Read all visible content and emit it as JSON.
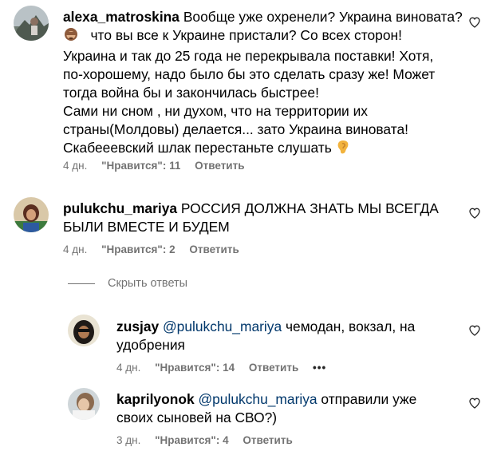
{
  "comments": [
    {
      "username": "alexa_matroskina",
      "lines": [
        " Вообще уже охренели? Украина виновата?",
        "   что вы все к Украине пристали? Со всех сторон!",
        "Украина и так до 25 года не перекрывала поставки! Хотя,",
        "по-хорошему, надо было бы это сделать сразу же! Может",
        "тогда война бы и закончилась быстрее!",
        "Сами ни сном , ни духом, что на территории их",
        "страны(Молдовы) делается... зато Украина виновата!",
        "Скабееевский шлак перестаньте слушать "
      ],
      "time": "4 дн.",
      "likes": "\"Нравится\": 11",
      "reply": "Ответить",
      "icons": {
        "emoji_1": "see-no-evil-monkey-emoji",
        "emoji_2": "ear-emoji",
        "like": "heart-outline-icon"
      }
    },
    {
      "username": "pulukchu_mariya",
      "lines": [
        " РОССИЯ ДОЛЖНА ЗНАТЬ МЫ ВСЕГДА",
        "БЫЛИ ВМЕСТЕ И БУДЕМ"
      ],
      "time": "4 дн.",
      "likes": "\"Нравится\": 2",
      "reply": "Ответить",
      "icons": {
        "like": "heart-outline-icon"
      }
    }
  ],
  "hide_replies": "Скрыть ответы",
  "replies": [
    {
      "username": "zusjay",
      "mention": "@pulukchu_mariya",
      "line1_rest": " чемодан, вокзал, на",
      "line2": "удобрения",
      "time": "4 дн.",
      "likes": "\"Нравится\": 14",
      "reply": "Ответить",
      "more": "•••",
      "icons": {
        "like": "heart-outline-icon",
        "more": "more-options-icon"
      }
    },
    {
      "username": "kaprilyonok",
      "mention": "@pulukchu_mariya",
      "line1_rest": " отправили уже",
      "line2": "своих сыновей на СВО?)",
      "time": "3 дн.",
      "likes": "\"Нравится\": 4",
      "reply": "Ответить",
      "icons": {
        "like": "heart-outline-icon"
      }
    }
  ],
  "colors": {
    "meta": "#737373",
    "mention": "#00376b",
    "text": "#000000"
  }
}
